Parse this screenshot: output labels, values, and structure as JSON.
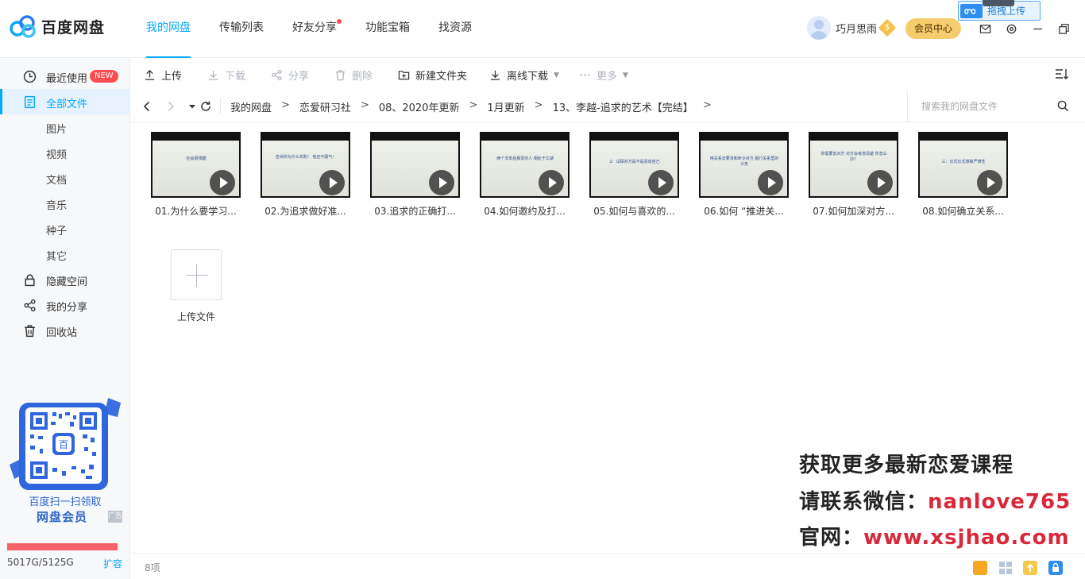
{
  "app": {
    "name": "百度网盘"
  },
  "nav": [
    {
      "label": "我的网盘",
      "active": true
    },
    {
      "label": "传输列表",
      "active": false
    },
    {
      "label": "好友分享",
      "active": false,
      "dot": true
    },
    {
      "label": "功能宝箱",
      "active": false
    },
    {
      "label": "找资源",
      "active": false
    }
  ],
  "user": {
    "name": "巧月思雨",
    "vip_mark": "$",
    "member_center": "会员中心"
  },
  "drag_upload": {
    "label": "拖拽上传"
  },
  "sidebar": {
    "items": [
      {
        "label": "最近使用",
        "badge": "NEW",
        "icon": "clock-icon"
      },
      {
        "label": "全部文件",
        "active": true,
        "icon": "file-icon"
      },
      {
        "label": "图片",
        "sub": true
      },
      {
        "label": "视频",
        "sub": true
      },
      {
        "label": "文档",
        "sub": true
      },
      {
        "label": "音乐",
        "sub": true
      },
      {
        "label": "种子",
        "sub": true
      },
      {
        "label": "其它",
        "sub": true
      },
      {
        "label": "隐藏空间",
        "icon": "lock-icon"
      },
      {
        "label": "我的分享",
        "icon": "share-icon"
      },
      {
        "label": "回收站",
        "icon": "trash-icon"
      }
    ],
    "promo": {
      "line1": "百度扫一扫领取",
      "line2": "网盘会员",
      "ad": "广告"
    },
    "quota": {
      "text": "5017G/5125G",
      "used_fraction": 0.979,
      "expand": "扩容"
    }
  },
  "toolbar": {
    "upload": "上传",
    "download": "下载",
    "share": "分享",
    "delete": "删除",
    "new_folder": "新建文件夹",
    "offline_download": "离线下载",
    "more": "更多"
  },
  "breadcrumb": [
    "我的网盘",
    "恋爱研习社",
    "08、2020年更新",
    "1月更新",
    "13、李越-追求的艺术【完结】"
  ],
  "search": {
    "placeholder": "搜索我的网盘文件"
  },
  "files": [
    {
      "name": "01.为什么要学习...",
      "thumb": "社会很残酷"
    },
    {
      "name": "02.为追求做好准...",
      "thumb": "告诉你为什么失败！ 他还不服气！"
    },
    {
      "name": "03.追求的正确打...",
      "thumb": ""
    },
    {
      "name": "04.如何邀约及打...",
      "thumb": "两个非单后相爱的人 相处于江湖"
    },
    {
      "name": "05.如何与喜欢的...",
      "thumb": "2：试探对方是不是喜欢自己"
    },
    {
      "name": "06.如何 “推进关...",
      "thumb": "用关系去要求和命令对方 履行关系里的义务"
    },
    {
      "name": "07.如何加深对方...",
      "thumb": "你需要去对方 对方会考虑清楚 你怎么办？"
    },
    {
      "name": "08.如何确立关系...",
      "thumb": "三：仪式仪式感和严肃性"
    }
  ],
  "upload_tile": {
    "label": "上传文件"
  },
  "promo_overlay": {
    "line1": "获取更多最新恋爱课程",
    "line2_prefix": "请联系微信：",
    "line2_accent": "nanlove765",
    "line3_prefix": "官网：",
    "line3_accent": "www.xsjhao.com"
  },
  "status": {
    "count": "8项"
  },
  "colors": {
    "accent": "#06a7ff",
    "quota": "#f26469",
    "promo_red": "#d9283a",
    "member_gold": "#f6cd6e"
  }
}
